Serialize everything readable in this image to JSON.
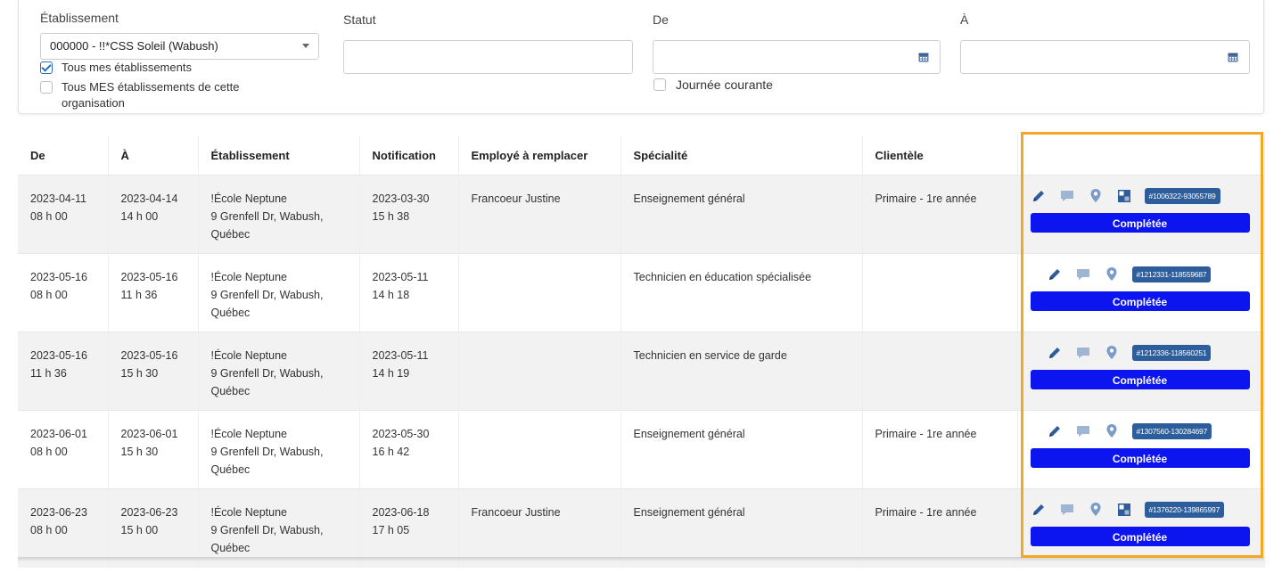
{
  "filters": {
    "etablissement_label": "Établissement",
    "etablissement_value": "000000 - !!*CSS Soleil (Wabush)",
    "tous_mes_label": "Tous mes établissements",
    "tous_mes_checked": true,
    "tous_org_label": "Tous MES établissements de cette organisation",
    "tous_org_checked": false,
    "statut_label": "Statut",
    "statut_value": "",
    "de_label": "De",
    "de_value": "",
    "a_label": "À",
    "a_value": "",
    "journee_label": "Journée courante",
    "journee_checked": false
  },
  "table": {
    "headers": [
      "De",
      "À",
      "Établissement",
      "Notification",
      "Employé à remplacer",
      "Spécialité",
      "Clientèle",
      ""
    ],
    "rows": [
      {
        "de": [
          "2023-04-11",
          "08 h 00"
        ],
        "a": [
          "2023-04-14",
          "14 h 00"
        ],
        "etab": [
          "!École Neptune",
          "9 Grenfell Dr, Wabush,",
          "Québec"
        ],
        "notif": [
          "2023-03-30",
          "15 h 38"
        ],
        "employe": "Francoeur Justine",
        "specialite": "Enseignement général",
        "clientele": "Primaire - 1re année",
        "id": "#1006322-93055789",
        "status": "Complétée",
        "has_extra_icon": true
      },
      {
        "de": [
          "2023-05-16",
          "08 h 00"
        ],
        "a": [
          "2023-05-16",
          "11 h 36"
        ],
        "etab": [
          "!École Neptune",
          "9 Grenfell Dr, Wabush,",
          "Québec"
        ],
        "notif": [
          "2023-05-11",
          "14 h 18"
        ],
        "employe": "",
        "specialite": "Technicien en éducation spécialisée",
        "clientele": "",
        "id": "#1212331-118559687",
        "status": "Complétée",
        "has_extra_icon": false
      },
      {
        "de": [
          "2023-05-16",
          "11 h 36"
        ],
        "a": [
          "2023-05-16",
          "15 h 30"
        ],
        "etab": [
          "!École Neptune",
          "9 Grenfell Dr, Wabush,",
          "Québec"
        ],
        "notif": [
          "2023-05-11",
          "14 h 19"
        ],
        "employe": "",
        "specialite": "Technicien en service de garde",
        "clientele": "",
        "id": "#1212336-118560251",
        "status": "Complétée",
        "has_extra_icon": false
      },
      {
        "de": [
          "2023-06-01",
          "08 h 00"
        ],
        "a": [
          "2023-06-01",
          "15 h 30"
        ],
        "etab": [
          "!École Neptune",
          "9 Grenfell Dr, Wabush,",
          "Québec"
        ],
        "notif": [
          "2023-05-30",
          "16 h 42"
        ],
        "employe": "",
        "specialite": "Enseignement général",
        "clientele": "Primaire - 1re année",
        "id": "#1307560-130284697",
        "status": "Complétée",
        "has_extra_icon": false
      },
      {
        "de": [
          "2023-06-23",
          "08 h 00"
        ],
        "a": [
          "2023-06-23",
          "15 h 00"
        ],
        "etab": [
          "!École Neptune",
          "9 Grenfell Dr, Wabush,",
          "Québec"
        ],
        "notif": [
          "2023-06-18",
          "17 h 05"
        ],
        "employe": "Francoeur Justine",
        "specialite": "Enseignement général",
        "clientele": "Primaire - 1re année",
        "id": "#1376220-139865997",
        "status": "Complétée",
        "has_extra_icon": true
      }
    ]
  },
  "icons": {
    "edit": "pencil-icon",
    "comment": "comment-icon",
    "location": "map-pin-icon",
    "document": "document-icon",
    "calendar": "calendar-icon"
  },
  "colors": {
    "status_button": "#0c14f0",
    "id_badge": "#2d5d9a",
    "highlight": "#f5a623",
    "accent": "#2c6fb6"
  }
}
